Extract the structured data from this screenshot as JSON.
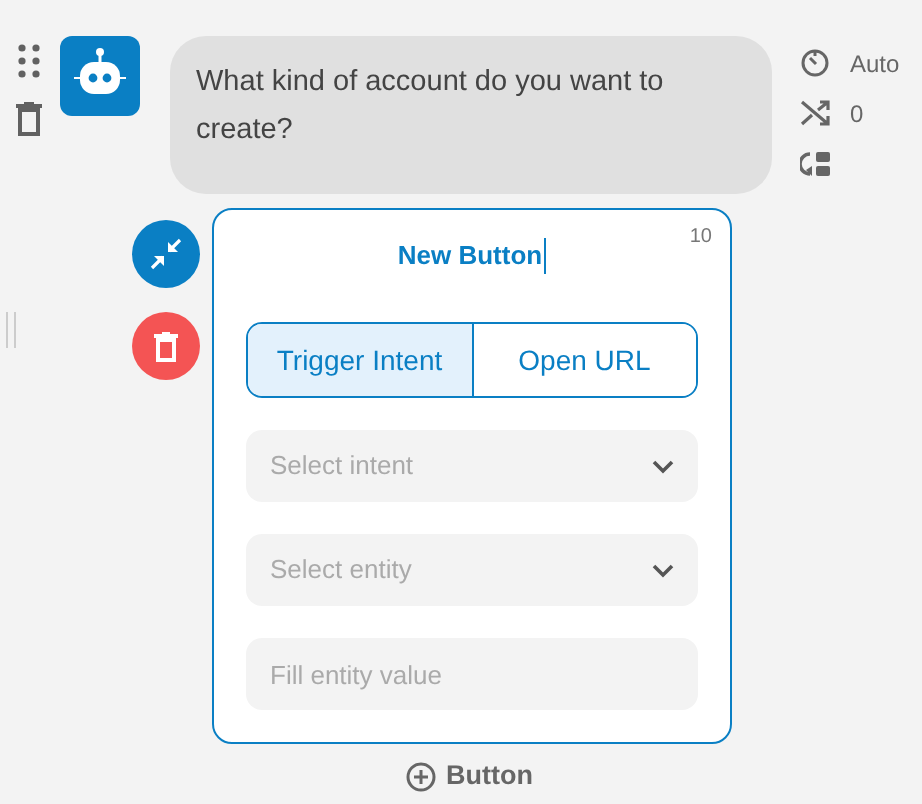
{
  "message": {
    "text": "What kind of account do you want to create?"
  },
  "settings": [
    {
      "kind": "delay",
      "value": "Auto"
    },
    {
      "kind": "random",
      "value": "0"
    },
    {
      "kind": "fallback"
    }
  ],
  "button_editor": {
    "title": "New Button",
    "editing": true,
    "counter": "10",
    "tabs": [
      {
        "label": "Trigger Intent",
        "selected": true
      },
      {
        "label": "Open URL",
        "selected": false
      }
    ],
    "fields": [
      {
        "kind": "select",
        "placeholder": "Select intent"
      },
      {
        "kind": "select",
        "placeholder": "Select entity"
      },
      {
        "kind": "input",
        "placeholder": "Fill entity value"
      }
    ]
  },
  "add_button": {
    "label": "Button"
  }
}
